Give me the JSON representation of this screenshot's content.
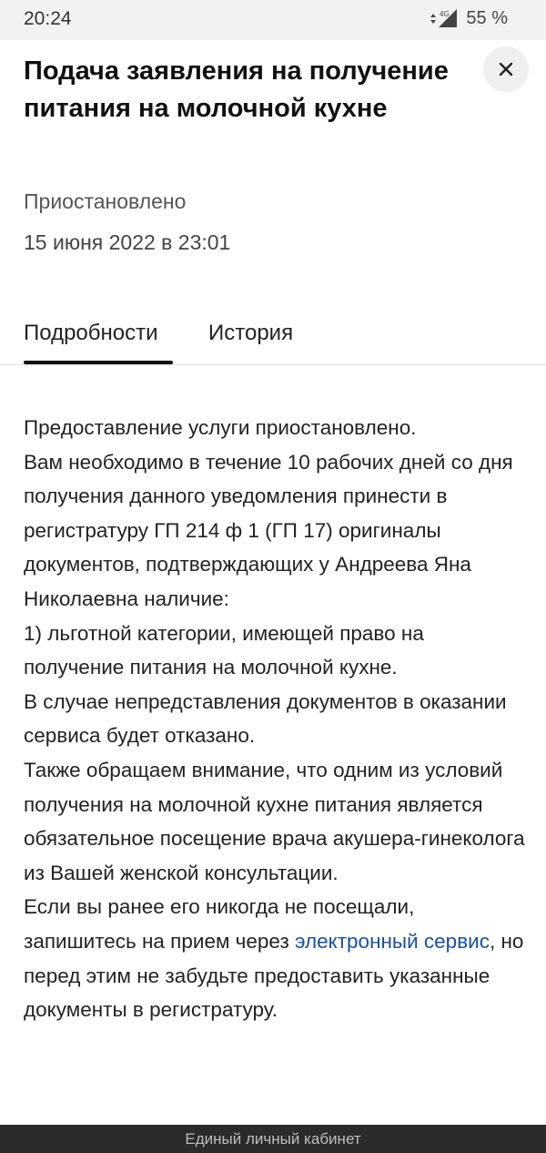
{
  "status_bar": {
    "time": "20:24",
    "network": "4G",
    "battery": "55 %"
  },
  "header": {
    "title": "Подача заявления на получение питания на молочной кухне",
    "close_icon": "close-icon"
  },
  "application": {
    "status": "Приостановлено",
    "date": "15 июня 2022 в 23:01"
  },
  "tabs": [
    {
      "label": "Подробности",
      "active": true
    },
    {
      "label": "История",
      "active": false
    }
  ],
  "details": {
    "lines": [
      "Предоставление услуги приостановлено.",
      "Вам необходимо в течение 10 рабочих дней со дня получения данного уведомления принести в регистратуру ГП 214 ф 1 (ГП 17) оригиналы документов, подтверждающих у Андреева Яна Николаевна наличие:",
      "1) льготной категории, имеющей право на получение питания на молочной кухне.",
      "В случае непредставления документов в оказании сервиса будет отказано.",
      "Также обращаем внимание, что одним из условий получения на молочной кухне питания является обязательное посещение врача акушера-гинеколога из Вашей женской консультации."
    ],
    "last_paragraph": {
      "before_link": "Если вы ранее его никогда не посещали, запишитесь на прием через ",
      "link_text": "электронный сервис",
      "after_link": ", но перед этим не забудьте предоставить указанные документы в регистратуру."
    },
    "link_color": "#1a4fa3"
  },
  "footer": {
    "label": "Единый личный кабинет"
  }
}
